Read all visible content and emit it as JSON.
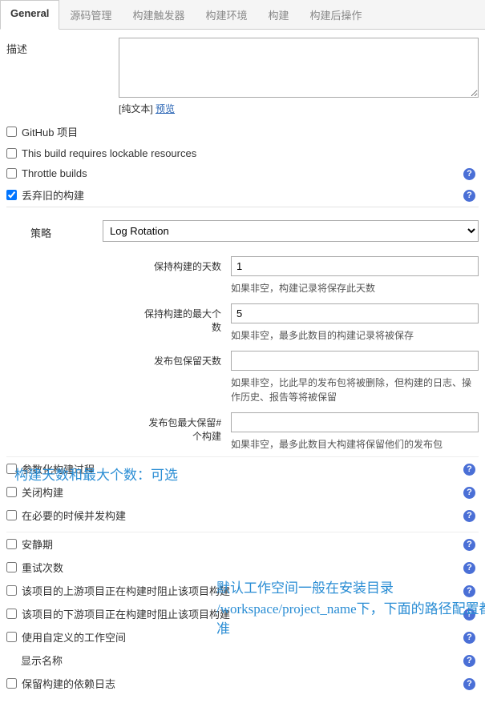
{
  "tabs": {
    "general": "General",
    "scm": "源码管理",
    "triggers": "构建触发器",
    "env": "构建环境",
    "build": "构建",
    "post": "构建后操作"
  },
  "description": {
    "label": "描述",
    "hint_prefix": "[纯文本]",
    "preview_link": "预览"
  },
  "checkboxes": {
    "github": "GitHub 项目",
    "lockable": "This build requires lockable resources",
    "throttle": "Throttle builds",
    "discard": "丢弃旧的构建",
    "parameterized": "参数化构建过程",
    "disable": "关闭构建",
    "concurrent": "在必要的时候并发构建",
    "quiet": "安静期",
    "retry": "重试次数",
    "upstream_block": "该项目的上游项目正在构建时阻止该项目构建",
    "downstream_block": "该项目的下游项目正在构建时阻止该项目构建",
    "custom_ws": "使用自定义的工作空间",
    "display_name": "显示名称",
    "keep_deps": "保留构建的依赖日志"
  },
  "strategy": {
    "label": "策略",
    "value": "Log Rotation",
    "days_label": "保持构建的天数",
    "days_value": "1",
    "days_desc": "如果非空，构建记录将保存此天数",
    "max_label": "保持构建的最大个数",
    "max_value": "5",
    "max_desc": "如果非空，最多此数目的构建记录将被保存",
    "artifact_days_label": "发布包保留天数",
    "artifact_days_desc": "如果非空，比此早的发布包将被删除，但构建的日志、操作历史、报告等将被保留",
    "artifact_max_label": "发布包最大保留#个构建",
    "artifact_max_desc": "如果非空，最多此数目大构建将保留他们的发布包"
  },
  "annotations": {
    "a1": "构建天数和最大个数：可选",
    "a2_line1": "默认工作空间一般在安装目录",
    "a2_line2": "/workspace/project_name下，下面的路径配置都相对此目录为准"
  },
  "icons": {
    "help": "?"
  }
}
